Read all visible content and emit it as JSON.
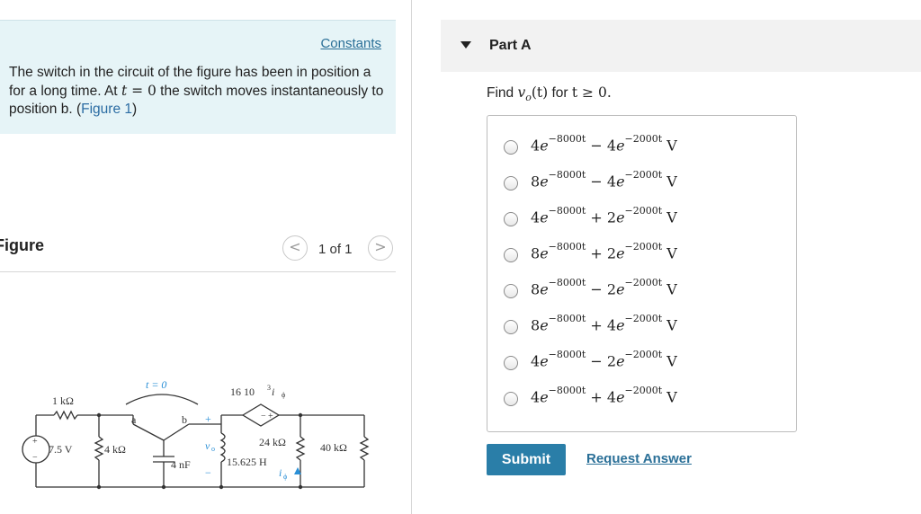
{
  "problem": {
    "constants_label": "Constants",
    "text_part1": "The switch in the circuit of the figure has been in position a for a long time. At ",
    "t_var": "t",
    "eq_zero": " = 0",
    "text_part2": " the switch moves instantaneously to position b. (",
    "figure_link": "Figure 1",
    "text_part3": ")"
  },
  "figure": {
    "title": "Figure",
    "page_indicator": "1 of 1",
    "prev_icon": "<",
    "next_icon": ">",
    "labels": {
      "r1": "1 kΩ",
      "source": "7.5 V",
      "r2": "4 kΩ",
      "switch_time": "t = 0",
      "pos_a": "a",
      "pos_b": "b",
      "cap": "4 nF",
      "vo": "v",
      "vo_sub": "o",
      "plus": "+",
      "minus": "−",
      "dep_source": "16  10",
      "dep_exp": "3",
      "dep_var": " i",
      "dep_sub": "ϕ",
      "inductor": "15.625 H",
      "r3": "24 kΩ",
      "r4": "40 kΩ",
      "iphi": "i",
      "iphi_sub": "ϕ"
    }
  },
  "part": {
    "title": "Part A",
    "question_prefix": "Find ",
    "question_math": "v",
    "question_sub": "o",
    "question_arg": "(t)",
    "question_mid": " for ",
    "question_cond": "t ≥ 0.",
    "options": [
      {
        "c1": "4",
        "e1": "−8000t",
        "op": " − ",
        "c2": "4",
        "e2": "−2000t"
      },
      {
        "c1": "8",
        "e1": "−8000t",
        "op": " − ",
        "c2": "4",
        "e2": "−2000t"
      },
      {
        "c1": "4",
        "e1": "−8000t",
        "op": " + ",
        "c2": "2",
        "e2": "−2000t"
      },
      {
        "c1": "8",
        "e1": "−8000t",
        "op": " + ",
        "c2": "2",
        "e2": "−2000t"
      },
      {
        "c1": "8",
        "e1": "−8000t",
        "op": " − ",
        "c2": "2",
        "e2": "−2000t"
      },
      {
        "c1": "8",
        "e1": "−8000t",
        "op": " + ",
        "c2": "4",
        "e2": "−2000t"
      },
      {
        "c1": "4",
        "e1": "−8000t",
        "op": " − ",
        "c2": "2",
        "e2": "−2000t"
      },
      {
        "c1": "4",
        "e1": "−8000t",
        "op": " + ",
        "c2": "4",
        "e2": "−2000t"
      }
    ],
    "unit": "V",
    "e_symbol": "e",
    "submit_label": "Submit",
    "request_label": "Request Answer"
  }
}
